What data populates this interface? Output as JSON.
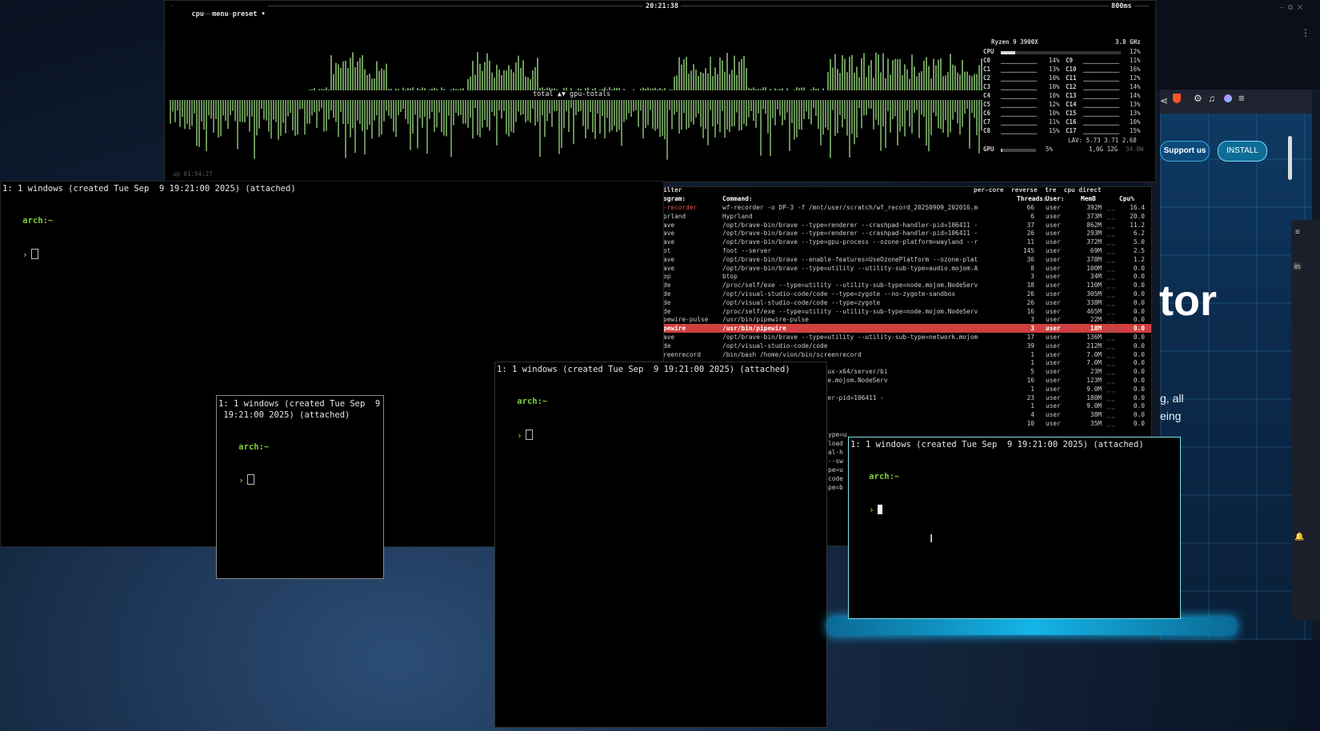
{
  "btop": {
    "menu": [
      "cpu",
      "menu",
      "preset"
    ],
    "clock": "20:21:38",
    "interval": "800ms",
    "graph_label": "total ▲▼ gpu-totals",
    "uptime": "up 01:54:27",
    "cpu_name": "Ryzen 9 3900X",
    "cpu_freq": "3.8 GHz",
    "cpu_total_label": "CPU",
    "cpu_total_pct": "12%",
    "cores": [
      {
        "a": "C0",
        "ap": "14%",
        "b": "C9",
        "bp": "11%"
      },
      {
        "a": "C1",
        "ap": "13%",
        "b": "C10",
        "bp": "16%"
      },
      {
        "a": "C2",
        "ap": "10%",
        "b": "C11",
        "bp": "12%"
      },
      {
        "a": "C3",
        "ap": "10%",
        "b": "C12",
        "bp": "14%"
      },
      {
        "a": "C4",
        "ap": "10%",
        "b": "C13",
        "bp": "14%"
      },
      {
        "a": "C5",
        "ap": "12%",
        "b": "C14",
        "bp": "13%"
      },
      {
        "a": "C6",
        "ap": "10%",
        "b": "C15",
        "bp": "13%"
      },
      {
        "a": "C7",
        "ap": "11%",
        "b": "C16",
        "bp": "10%"
      },
      {
        "a": "C8",
        "ap": "15%",
        "b": "C17",
        "bp": "15%"
      }
    ],
    "lav": "LAV: 5.73 3.71 2.68",
    "gpu_label": "GPU",
    "gpu_pct": "5%",
    "gpu_mem": "1,0G 12G",
    "gpu_temp": "34.0W"
  },
  "proc": {
    "filter": "ilter",
    "options": "per-core  reverse  tre  cpu direct",
    "headers": {
      "program": "ogram:",
      "command": "Command:",
      "threads": "Threads:",
      "user": "User:",
      "mem": "MemB",
      "cpu": "Cpu%"
    },
    "rows": [
      {
        "p": "-recorder",
        "c": "wf-recorder -o DP-3 -f /mnt/user/scratch/wf_record_20250909_202016.m",
        "t": "66",
        "u": "user",
        "m": "392M",
        "cp": "16.4",
        "hot": true
      },
      {
        "p": "prland",
        "c": "Hyprland",
        "t": "6",
        "u": "user",
        "m": "373M",
        "cp": "20.0"
      },
      {
        "p": "ave",
        "c": "/opt/brave-bin/brave --type=renderer --crashpad-handler-pid=106411 -",
        "t": "37",
        "u": "user",
        "m": "862M",
        "cp": "11.2"
      },
      {
        "p": "ave",
        "c": "/opt/brave-bin/brave --type=renderer --crashpad-handler-pid=106411 -",
        "t": "26",
        "u": "user",
        "m": "293M",
        "cp": "6.2"
      },
      {
        "p": "ave",
        "c": "/opt/brave-bin/brave --type=gpu-process --ozone-platform=wayland --r",
        "t": "11",
        "u": "user",
        "m": "372M",
        "cp": "5.0"
      },
      {
        "p": "ot",
        "c": "foot --server",
        "t": "145",
        "u": "user",
        "m": "69M",
        "cp": "2.5"
      },
      {
        "p": "ave",
        "c": "/opt/brave-bin/brave --enable-features=UseOzonePlatform --ozone-plat",
        "t": "36",
        "u": "user",
        "m": "378M",
        "cp": "1.2"
      },
      {
        "p": "ave",
        "c": "/opt/brave-bin/brave --type=utility --utility-sub-type=audio.mojom.A",
        "t": "8",
        "u": "user",
        "m": "100M",
        "cp": "0.0"
      },
      {
        "p": "op",
        "c": "btop",
        "t": "3",
        "u": "user",
        "m": "34M",
        "cp": "0.0"
      },
      {
        "p": "de",
        "c": "/proc/self/exe --type=utility --utility-sub-type=node.mojom.NodeServ",
        "t": "18",
        "u": "user",
        "m": "110M",
        "cp": "0.0"
      },
      {
        "p": "de",
        "c": "/opt/visual-studio-code/code --type=zygote --no-zygote-sandbox",
        "t": "26",
        "u": "user",
        "m": "305M",
        "cp": "0.0"
      },
      {
        "p": "de",
        "c": "/opt/visual-studio-code/code --type=zygote",
        "t": "26",
        "u": "user",
        "m": "338M",
        "cp": "0.0"
      },
      {
        "p": "de",
        "c": "/proc/self/exe --type=utility --utility-sub-type=node.mojom.NodeServ",
        "t": "16",
        "u": "user",
        "m": "465M",
        "cp": "0.0"
      },
      {
        "p": "pewire-pulse",
        "c": "/usr/bin/pipewire-pulse",
        "t": "3",
        "u": "user",
        "m": "22M",
        "cp": "0.0"
      },
      {
        "p": "pewire",
        "c": "/usr/bin/pipewire",
        "t": "3",
        "u": "user",
        "m": "18M",
        "cp": "0.0",
        "sel": true
      },
      {
        "p": "ave",
        "c": "/opt/brave-bin/brave --type=utility --utility-sub-type=network.mojom",
        "t": "17",
        "u": "user",
        "m": "136M",
        "cp": "0.0"
      },
      {
        "p": "de",
        "c": "/opt/visual-studio-code/code",
        "t": "39",
        "u": "user",
        "m": "212M",
        "cp": "0.0"
      },
      {
        "p": "reenrecord",
        "c": "/bin/bash /home/vion/bin/screenrecord",
        "t": "1",
        "u": "user",
        "m": "7.0M",
        "cp": "0.0"
      },
      {
        "p": "",
        "c": "",
        "t": "1",
        "u": "user",
        "m": "7.0M",
        "cp": "0.0"
      },
      {
        "p": "",
        "c": "sions/sumneko.lua-3.15.0-linux-x64/server/bi",
        "t": "5",
        "u": "user",
        "m": "23M",
        "cp": "0.0"
      },
      {
        "p": "",
        "c": "ility --utility-sub-type=node.mojom.NodeServ",
        "t": "16",
        "u": "user",
        "m": "123M",
        "cp": "0.0"
      },
      {
        "p": "",
        "c": "",
        "t": "1",
        "u": "user",
        "m": "9.0M",
        "cp": "0.0"
      },
      {
        "p": "",
        "c": "pe=renderer --crashpad-handler-pid=106411 -",
        "t": "23",
        "u": "user",
        "m": "180M",
        "cp": "0.0"
      },
      {
        "p": "",
        "c": "",
        "t": "1",
        "u": "user",
        "m": "9.0M",
        "cp": "0.0"
      },
      {
        "p": "",
        "c": "ractor-3 --socket-fd 3",
        "t": "4",
        "u": "user",
        "m": "38M",
        "cp": "0.0"
      },
      {
        "p": "",
        "c": "",
        "t": "10",
        "u": "user",
        "m": "35M",
        "cp": "0.0"
      }
    ],
    "fragments": [
      "ype=u",
      "load",
      "al-h",
      "--sw",
      "pe=u",
      "code",
      "pe=b"
    ]
  },
  "terminals": {
    "banner": "1: 1 windows (created Tue Sep  9 19:21:00 2025) (attached)",
    "banner_wrap_1": "1: 1 windows (created Tue Sep  9",
    "banner_wrap_2": " 19:21:00 2025) (attached)",
    "prompt_host": "arch:~",
    "prompt_symbol": "›"
  },
  "browser": {
    "support_label": "Support us",
    "install_label": "INSTALL",
    "hero_text": "tor",
    "sub_text_1": "g, all",
    "sub_text_2": "eing",
    "lin_label": "in"
  },
  "colors": {
    "graph": "#7fb36a",
    "prompt": "#7ccf3a",
    "selection": "#d04040",
    "accent": "#2aa8d8"
  }
}
